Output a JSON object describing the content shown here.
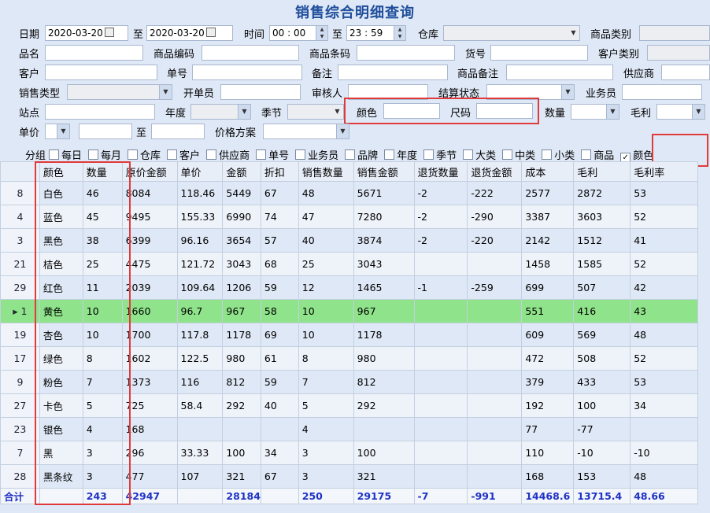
{
  "title": "销售综合明细查询",
  "filters": {
    "date_label": "日期",
    "date_from": "2020-03-20",
    "date_to_label": "至",
    "date_to": "2020-03-20",
    "time_label": "时间",
    "time_from": "00 : 00",
    "time_to_label": "至",
    "time_to": "23 : 59",
    "warehouse_label": "仓库",
    "category_label": "商品类别",
    "name_label": "品名",
    "code_label": "商品编码",
    "barcode_label": "商品条码",
    "item_no_label": "货号",
    "customer_type_label": "客户类别",
    "customer_label": "客户",
    "order_no_label": "单号",
    "remark_label": "备注",
    "product_remark_label": "商品备注",
    "supplier_label": "供应商",
    "sale_type_label": "销售类型",
    "maker_label": "开单员",
    "auditor_label": "审核人",
    "settle_label": "结算状态",
    "salesman_label": "业务员",
    "site_label": "站点",
    "year_label": "年度",
    "season_label": "季节",
    "color_label": "颜色",
    "size_label": "尺码",
    "qty_label": "数量",
    "profit_label": "毛利",
    "price_label": "单价",
    "price_to_label": "至",
    "price_plan_label": "价格方案"
  },
  "group": {
    "label": "分组",
    "options": [
      {
        "label": "每日",
        "checked": false
      },
      {
        "label": "每月",
        "checked": false
      },
      {
        "label": "仓库",
        "checked": false
      },
      {
        "label": "客户",
        "checked": false
      },
      {
        "label": "供应商",
        "checked": false
      },
      {
        "label": "单号",
        "checked": false
      },
      {
        "label": "业务员",
        "checked": false
      },
      {
        "label": "品牌",
        "checked": false
      },
      {
        "label": "年度",
        "checked": false
      },
      {
        "label": "季节",
        "checked": false
      },
      {
        "label": "大类",
        "checked": false
      },
      {
        "label": "中类",
        "checked": false
      },
      {
        "label": "小类",
        "checked": false
      },
      {
        "label": "商品",
        "checked": false
      },
      {
        "label": "颜色",
        "checked": true
      }
    ]
  },
  "table": {
    "columns": [
      "",
      "颜色",
      "数量",
      "原价金额",
      "单价",
      "金额",
      "折扣",
      "销售数量",
      "销售金额",
      "退货数量",
      "退货金额",
      "成本",
      "毛利",
      "毛利率"
    ],
    "rows": [
      [
        "8",
        "白色",
        "46",
        "8084",
        "118.46",
        "5449",
        "67",
        "48",
        "5671",
        "-2",
        "-222",
        "2577",
        "2872",
        "53"
      ],
      [
        "4",
        "蓝色",
        "45",
        "9495",
        "155.33",
        "6990",
        "74",
        "47",
        "7280",
        "-2",
        "-290",
        "3387",
        "3603",
        "52"
      ],
      [
        "3",
        "黑色",
        "38",
        "6399",
        "96.16",
        "3654",
        "57",
        "40",
        "3874",
        "-2",
        "-220",
        "2142",
        "1512",
        "41"
      ],
      [
        "21",
        "桔色",
        "25",
        "4475",
        "121.72",
        "3043",
        "68",
        "25",
        "3043",
        "",
        "",
        "1458",
        "1585",
        "52"
      ],
      [
        "29",
        "红色",
        "11",
        "2039",
        "109.64",
        "1206",
        "59",
        "12",
        "1465",
        "-1",
        "-259",
        "699",
        "507",
        "42"
      ],
      [
        "1",
        "黄色",
        "10",
        "1660",
        "96.7",
        "967",
        "58",
        "10",
        "967",
        "",
        "",
        "551",
        "416",
        "43"
      ],
      [
        "19",
        "杏色",
        "10",
        "1700",
        "117.8",
        "1178",
        "69",
        "10",
        "1178",
        "",
        "",
        "609",
        "569",
        "48"
      ],
      [
        "17",
        "绿色",
        "8",
        "1602",
        "122.5",
        "980",
        "61",
        "8",
        "980",
        "",
        "",
        "472",
        "508",
        "52"
      ],
      [
        "9",
        "粉色",
        "7",
        "1373",
        "116",
        "812",
        "59",
        "7",
        "812",
        "",
        "",
        "379",
        "433",
        "53"
      ],
      [
        "27",
        "卡色",
        "5",
        "725",
        "58.4",
        "292",
        "40",
        "5",
        "292",
        "",
        "",
        "192",
        "100",
        "34"
      ],
      [
        "23",
        "银色",
        "4",
        "168",
        "",
        "",
        "",
        "4",
        "",
        "",
        "",
        "77",
        "-77",
        ""
      ],
      [
        "7",
        "黑",
        "3",
        "296",
        "33.33",
        "100",
        "34",
        "3",
        "100",
        "",
        "",
        "110",
        "-10",
        "-10"
      ],
      [
        "28",
        "黑条纹",
        "3",
        "477",
        "107",
        "321",
        "67",
        "3",
        "321",
        "",
        "",
        "168",
        "153",
        "48"
      ]
    ],
    "selected_index": 5,
    "total": [
      "合计",
      "",
      "243",
      "42947",
      "",
      "28184",
      "",
      "250",
      "29175",
      "-7",
      "-991",
      "14468.6",
      "13715.4",
      "48.66"
    ]
  }
}
